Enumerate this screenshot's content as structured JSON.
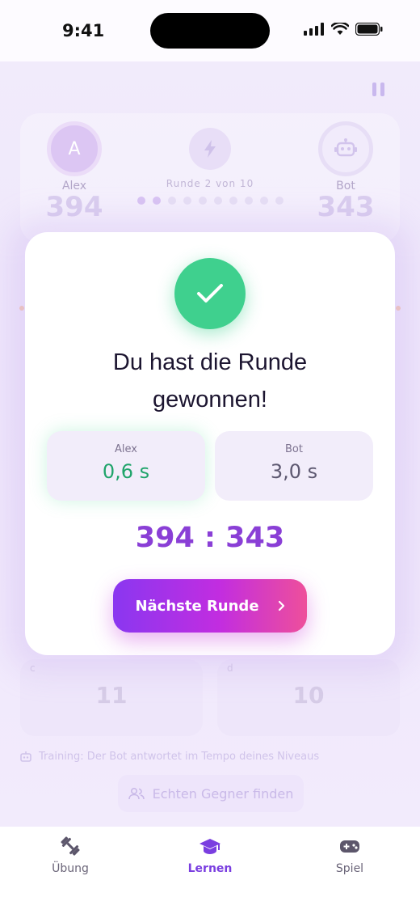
{
  "status_bar": {
    "time": "9:41"
  },
  "game": {
    "player_left": {
      "initial": "A",
      "name": "Alex",
      "score": "394"
    },
    "player_right": {
      "name": "Bot",
      "score": "343"
    },
    "round_label": "Runde 2 von 10",
    "round_progress": {
      "current": 2,
      "total": 10
    },
    "answer_cards": [
      {
        "label": "c",
        "value": "11"
      },
      {
        "label": "d",
        "value": "10"
      }
    ],
    "training_hint": "Training: Der Bot antwortet im Tempo deines Niveaus",
    "find_opponent_label": "Echten Gegner finden"
  },
  "modal": {
    "headline": "Du hast die Runde gewonnen!",
    "alex": {
      "name": "Alex",
      "time": "0,6 s"
    },
    "bot": {
      "name": "Bot",
      "time": "3,0 s"
    },
    "score_line": "394 : 343",
    "next_button_label": "Nächste Runde",
    "colors": {
      "success": "#3fd08e",
      "accent": "#8a3fd6",
      "button_start": "#8a37f0",
      "button_end": "#ee4f9b"
    }
  },
  "bottom_nav": {
    "items": [
      {
        "label": "Übung",
        "icon": "dumbbell-icon",
        "active": false
      },
      {
        "label": "Lernen",
        "icon": "graduation-cap-icon",
        "active": true
      },
      {
        "label": "Spiel",
        "icon": "gamepad-icon",
        "active": false
      }
    ]
  }
}
